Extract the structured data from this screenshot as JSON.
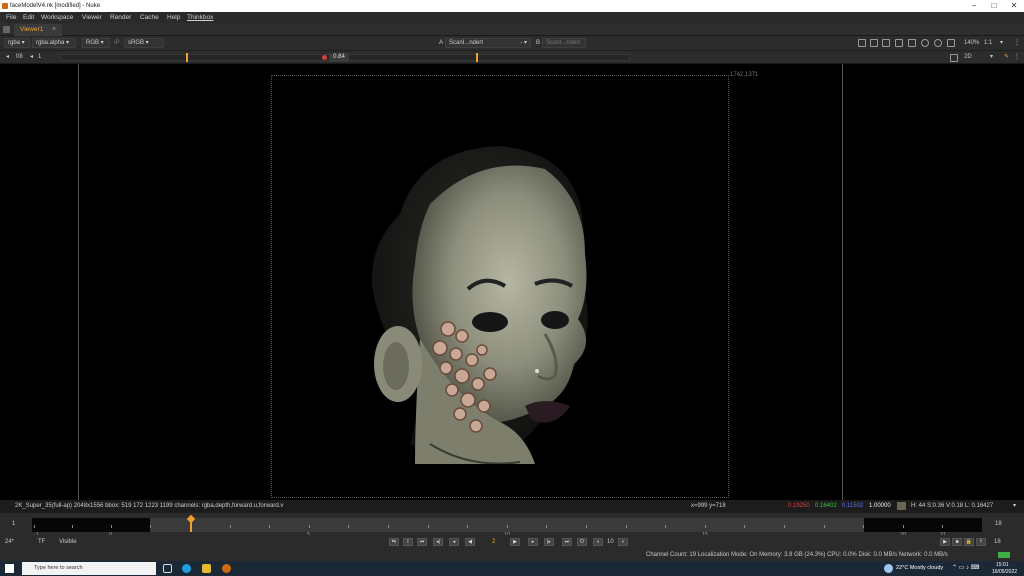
{
  "window": {
    "title": "faceModelV4.nk [modified] - Nuke"
  },
  "menu": [
    "File",
    "Edit",
    "Workspace",
    "Viewer",
    "Render",
    "Cache",
    "Help",
    "Thinkbox"
  ],
  "tab": {
    "label": "Viewer1",
    "close": "×"
  },
  "toolbar1": {
    "channels": "rgba",
    "alpha": "rgba.alpha",
    "display": "RGB",
    "ip": "IP",
    "lut": "sRGB",
    "input_a_letter": "A",
    "input_a": "ScanI...ndert",
    "input_b_letter": "B",
    "input_b": "ScanI...ndert",
    "zoom": "140%",
    "proxy": "1:1"
  },
  "toolbar2": {
    "fstop": "f/8",
    "frame_step": "1",
    "gain": "0.84",
    "view_mode": "2D"
  },
  "viewer": {
    "format_size": "1742,1371"
  },
  "info": {
    "left": "2K_Super_35(full-ap) 2048x1556  bbox: 519 172 1223 1199 channels: rgba,depth,forward.u,forward.v",
    "coords": "x=999 y=718",
    "r": "0.19250",
    "g": "0.16402",
    "b": "0.11502",
    "a": "1.00000",
    "hsv": "H: 44 S:0.36 V:0.18  L: 0.16427"
  },
  "timeline": {
    "start": "1",
    "end": "18",
    "labels": [
      "-1",
      "0",
      "5",
      "10",
      "15",
      "20",
      "21"
    ]
  },
  "playback": {
    "fps": "24*",
    "tf": "TF",
    "visible": "Visible",
    "frame": "2",
    "step": "10",
    "end_frame": "18"
  },
  "status": "Channel Count: 19  Localization Mode: On  Memory: 3.8 GB (24.3%)  CPU: 0.0%  Disk: 0.0 MB/s  Network: 0.0 MB/s",
  "taskbar": {
    "search": "Type here to search",
    "weather": "22°C  Mostly cloudy",
    "time": "15:01",
    "date": "16/05/2022"
  },
  "colors": {
    "accent": "#f0a030",
    "red": "#e04040",
    "green": "#40c040",
    "blue": "#5070ff"
  }
}
